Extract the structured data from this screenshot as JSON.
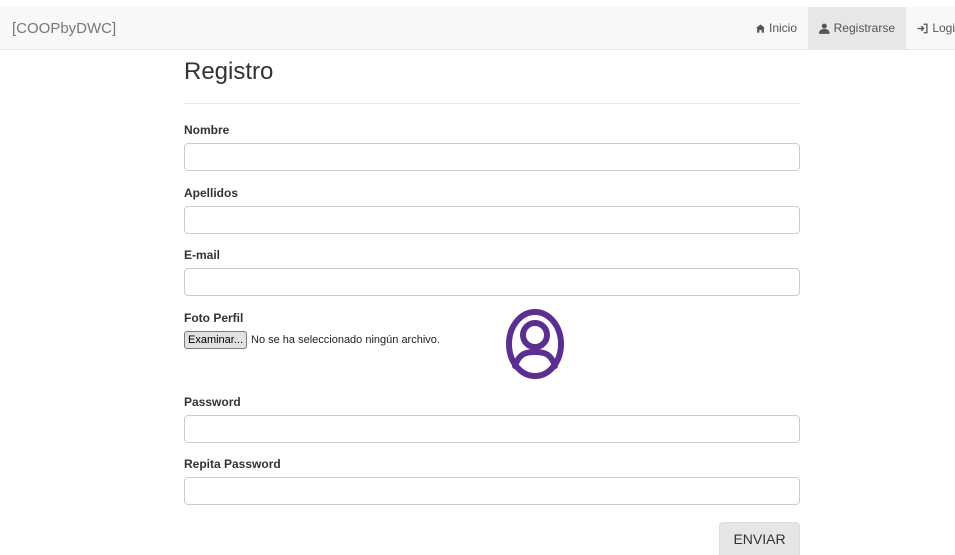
{
  "navbar": {
    "brand": "[COOPbyDWC]",
    "items": [
      {
        "label": "Inicio",
        "icon": "home-icon"
      },
      {
        "label": "Registrarse",
        "icon": "user-icon",
        "active": true
      },
      {
        "label": "Logi",
        "icon": "login-icon"
      }
    ]
  },
  "form": {
    "title": "Registro",
    "fields": {
      "nombre": {
        "label": "Nombre",
        "value": ""
      },
      "apellidos": {
        "label": "Apellidos",
        "value": ""
      },
      "email": {
        "label": "E-mail",
        "value": ""
      },
      "foto": {
        "label": "Foto Perfil",
        "button": "Examinar...",
        "status": "No se ha seleccionado ningún archivo."
      },
      "password": {
        "label": "Password",
        "value": ""
      },
      "repita_password": {
        "label": "Repita Password",
        "value": ""
      }
    },
    "submit_label": "ENVIAR"
  },
  "colors": {
    "avatar": "#5b2f8f",
    "navbar_bg": "#f8f8f8",
    "active_nav_bg": "#e7e7e7"
  }
}
